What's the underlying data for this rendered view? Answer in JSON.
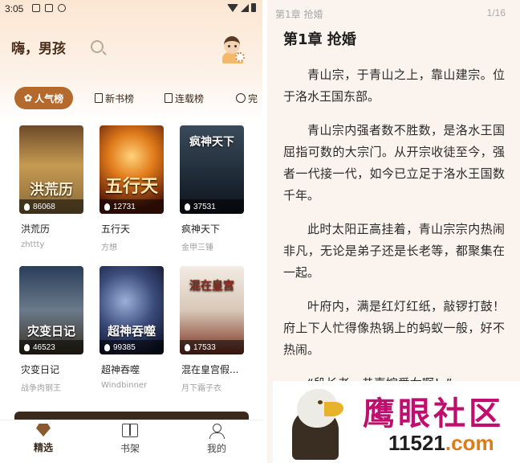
{
  "status_bar": {
    "time": "3:05"
  },
  "home": {
    "greeting": "嗨，男孩",
    "tabs": [
      {
        "label": "人气榜",
        "icon": "flower-icon",
        "active": true
      },
      {
        "label": "新书榜",
        "icon": "document-icon"
      },
      {
        "label": "连载榜",
        "icon": "bookmark-icon"
      },
      {
        "label": "完",
        "icon": "check-circle-icon"
      }
    ],
    "books": [
      {
        "cover_title": "洪荒历",
        "heat": "86068",
        "name": "洪荒历",
        "author": "zhttty"
      },
      {
        "cover_title": "五行天",
        "heat": "12731",
        "name": "五行天",
        "author": "方想"
      },
      {
        "cover_title": "疯神天下",
        "heat": "37531",
        "name": "疯神天下",
        "author": "金甲三锤"
      },
      {
        "cover_title": "灾变日记",
        "heat": "46523",
        "name": "灾变日记",
        "author": "战争肉钢王"
      },
      {
        "cover_title": "超神吞噬",
        "heat": "99385",
        "name": "超神吞噬",
        "author": "Windbinner"
      },
      {
        "cover_title": "混在皇宫",
        "heat": "17533",
        "name": "混在皇宫假...",
        "author": "月下霜子衣"
      }
    ],
    "nav": [
      {
        "label": "精选",
        "icon": "diamond-icon",
        "active": true
      },
      {
        "label": "书架",
        "icon": "book-shelf-icon"
      },
      {
        "label": "我的",
        "icon": "person-icon"
      }
    ]
  },
  "reader": {
    "header": "第1章 抢婚",
    "page": "1/16",
    "chapter_title": "第1章 抢婚",
    "paragraphs": [
      "青山宗，于青山之上，靠山建宗。位于洛水王国东部。",
      "青山宗内强者数不胜数，是洛水王国屈指可数的大宗门。从开宗收徒至今，强者一代接一代，如今已立足于洛水王国数千年。",
      "此时太阳正高挂着，青山宗宗内热闹非凡，无论是弟子还是长老等，都聚集在一起。",
      "叶府内，满是红灯红纸，敲锣打鼓！府上下人忙得像热锅上的蚂蚁一般，好不热闹。",
      "“段长老，恭喜嫁爱女啊！”"
    ]
  },
  "watermark": {
    "text": "鹰眼社区",
    "url_prefix": "11521",
    "url_suffix": ".com"
  }
}
